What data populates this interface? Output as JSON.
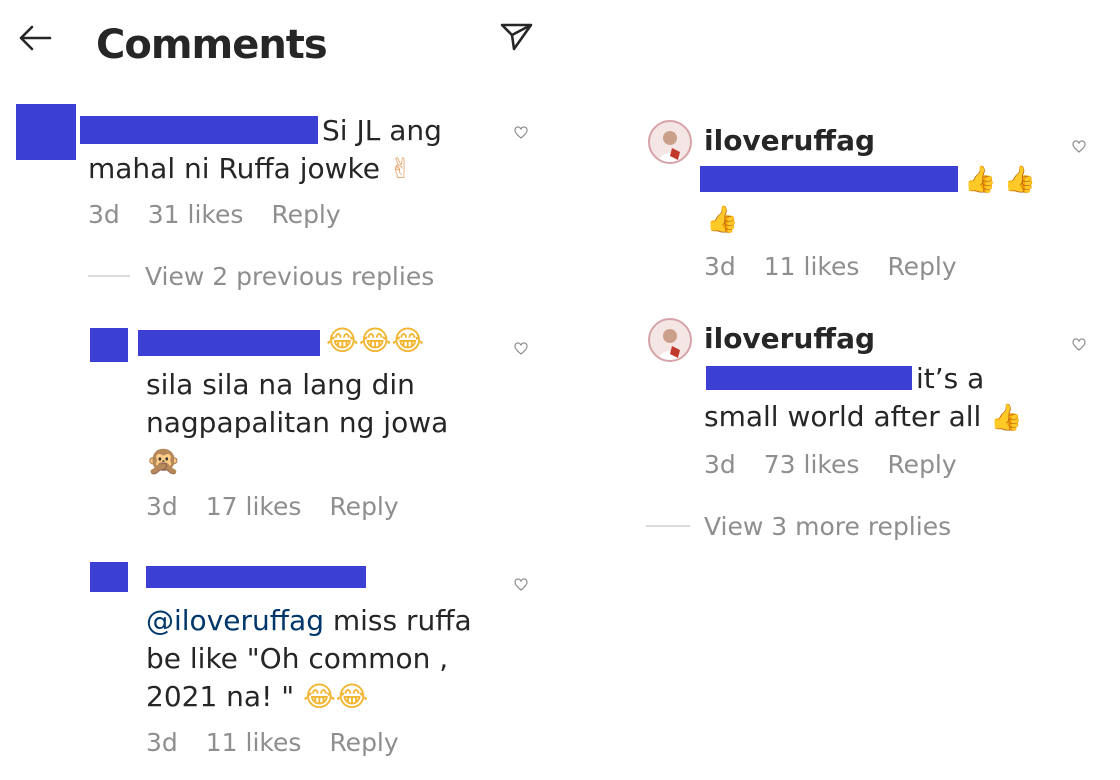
{
  "header": {
    "title": "Comments",
    "back_icon": "arrow-left-icon",
    "share_icon": "paper-plane-icon"
  },
  "left_column": {
    "comment1": {
      "text_line1": "Si JL ang",
      "text_line2": "mahal ni Ruffa jowke",
      "emoji": "victory-hand",
      "time": "3d",
      "likes": "31 likes",
      "reply": "Reply"
    },
    "view_previous": "View 2 previous replies",
    "reply1": {
      "emojis": "😂😂😂",
      "text_line1": "sila sila na lang din",
      "text_line2": "nagpapalitan ng jowa",
      "emoji2": "🙊",
      "time": "3d",
      "likes": "17 likes",
      "reply": "Reply"
    },
    "reply2": {
      "mention": "@iloveruffag",
      "text_line1": " miss ruffa",
      "text_line2": "be like \"Oh common ,",
      "text_line3": "2021 na! \" ",
      "emojis": "😂😂",
      "time": "3d",
      "likes": "11 likes",
      "reply": "Reply"
    }
  },
  "right_column": {
    "reply3": {
      "username": "iloveruffag",
      "time": "3d",
      "likes": "11 likes",
      "reply": "Reply"
    },
    "reply4": {
      "username": "iloveruffag",
      "text_line1": "it’s a",
      "text_line2": "small world after all",
      "time": "3d",
      "likes": "73 likes",
      "reply": "Reply"
    },
    "view_more": "View 3 more replies"
  },
  "colors": {
    "redaction": "#3b3fd4",
    "meta_gray": "#8e8e8e",
    "mention_blue": "#00376b"
  }
}
